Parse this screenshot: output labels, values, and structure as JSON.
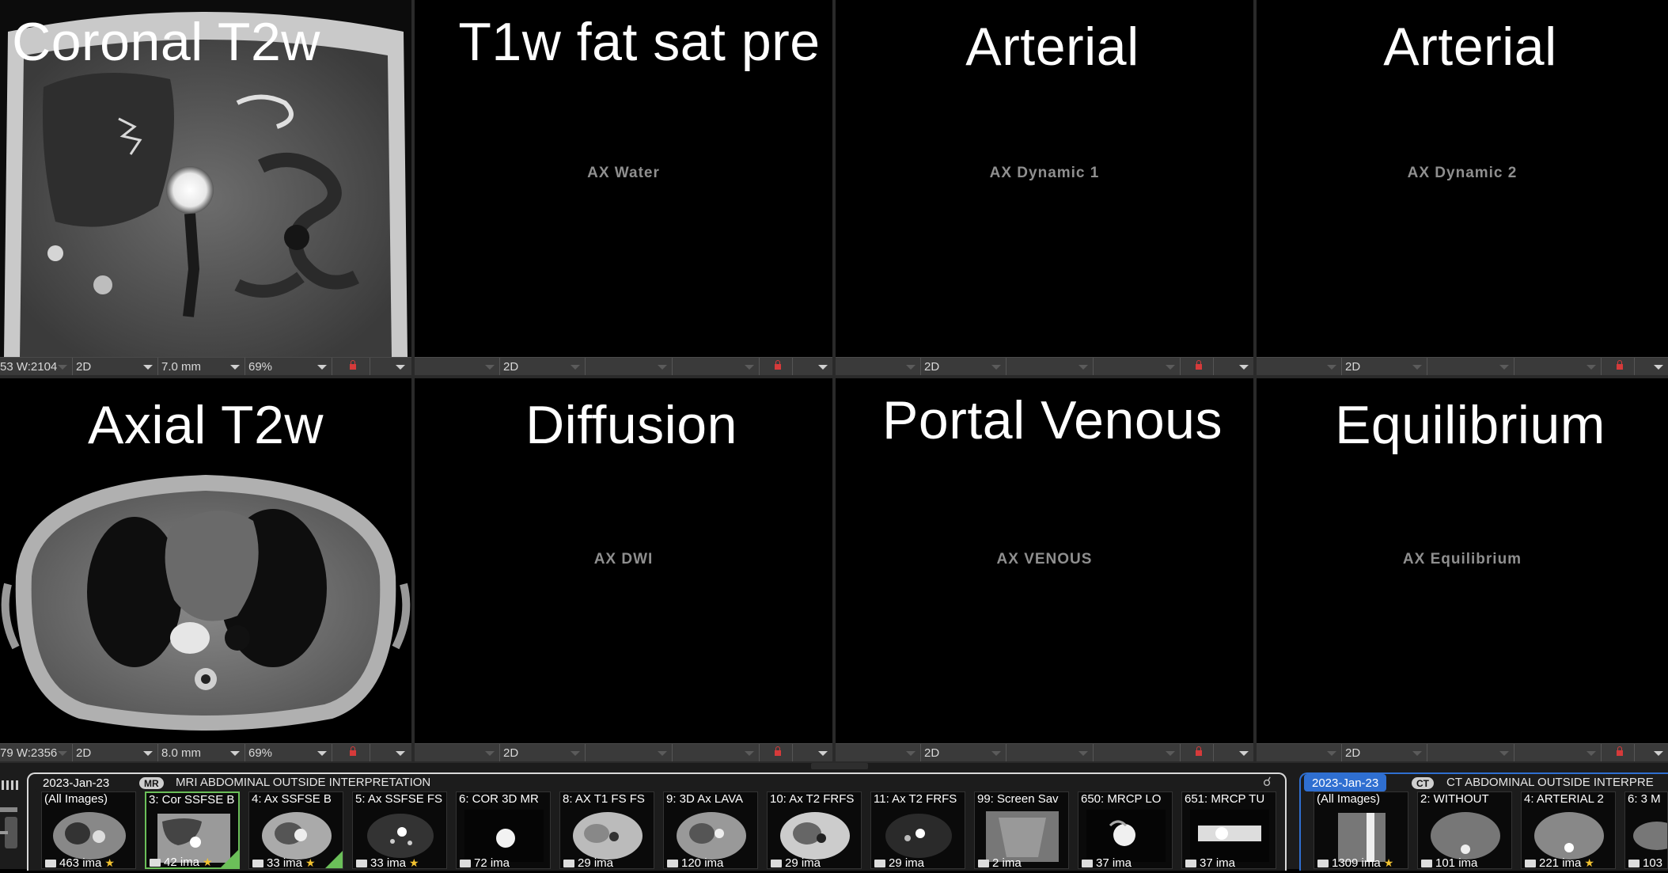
{
  "viewports": [
    {
      "title": "Coronal T2w",
      "series": "",
      "wl": "53 W:2104",
      "mode": "2D",
      "thickness": "7.0 mm",
      "zoom": "69%"
    },
    {
      "title": "T1w fat sat pre",
      "series": "AX Water",
      "mode": "2D"
    },
    {
      "title": "Arterial",
      "series": "AX Dynamic 1",
      "mode": "2D"
    },
    {
      "title": "Arterial",
      "series": "AX Dynamic 2",
      "mode": "2D"
    },
    {
      "title": "Axial T2w",
      "series": "",
      "wl": "79 W:2356",
      "mode": "2D",
      "thickness": "8.0 mm",
      "zoom": "69%"
    },
    {
      "title": "Diffusion",
      "series": "AX DWI",
      "mode": "2D"
    },
    {
      "title": "Portal Venous",
      "series": "AX VENOUS",
      "mode": "2D"
    },
    {
      "title": "Equilibrium",
      "series": "AX Equilibrium",
      "mode": "2D"
    }
  ],
  "studies": [
    {
      "date": "2023-Jan-23",
      "modality": "MR",
      "description": "MRI ABDOMINAL OUTSIDE INTERPRETATION",
      "thumbs": [
        {
          "label": "(All Images)",
          "count": "463 ima"
        },
        {
          "label": "3: Cor SSFSE B",
          "count": "42 ima"
        },
        {
          "label": "4: Ax SSFSE B",
          "count": "33 ima"
        },
        {
          "label": "5: Ax SSFSE FS",
          "count": "33 ima"
        },
        {
          "label": "6: COR 3D MR",
          "count": "72 ima"
        },
        {
          "label": "8: AX T1 FS FS",
          "count": "29 ima"
        },
        {
          "label": "9: 3D Ax LAVA",
          "count": "120 ima"
        },
        {
          "label": "10: Ax T2 FRFS",
          "count": "29 ima"
        },
        {
          "label": "11: Ax T2 FRFS",
          "count": "29 ima"
        },
        {
          "label": "99: Screen Sav",
          "count": "2 ima"
        },
        {
          "label": "650: MRCP LO",
          "count": "37 ima"
        },
        {
          "label": "651: MRCP TU",
          "count": "37 ima"
        }
      ]
    },
    {
      "date": "2023-Jan-23",
      "modality": "CT",
      "description": "CT ABDOMINAL OUTSIDE INTERPRE",
      "thumbs": [
        {
          "label": "(All Images)",
          "count": "1309 ima"
        },
        {
          "label": "2: WITHOUT",
          "count": "101 ima"
        },
        {
          "label": "4: ARTERIAL 2",
          "count": "221 ima"
        },
        {
          "label": "6: 3 M",
          "count": "103"
        }
      ]
    }
  ],
  "colors": {
    "active_border": "#c8862a",
    "selected_thumb": "#6bbf59",
    "ct_study": "#2f6fd1",
    "lock": "#d63a3a",
    "star": "#f2c230"
  }
}
